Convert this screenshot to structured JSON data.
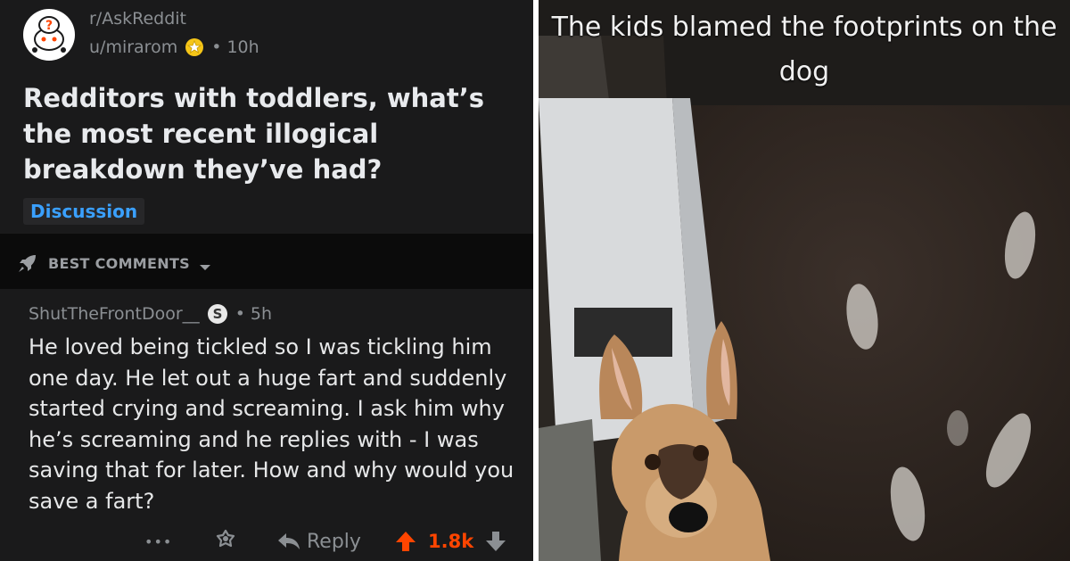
{
  "post": {
    "subreddit": "r/AskReddit",
    "author": "u/mirarom",
    "time": "• 10h",
    "title": "Redditors with toddlers, what’s the most recent illogical breakdown they’ve had?",
    "flair": "Discussion"
  },
  "sort": {
    "label": "BEST COMMENTS"
  },
  "comment": {
    "author": "ShutTheFrontDoor__",
    "time": "• 5h",
    "body": "He loved being tickled so I was tickling him one day. He let out a huge fart and suddenly started crying and screaming. I ask him why he’s screaming and he replies with - I was saving that for later. How and why would you save a fart?",
    "more": "•••",
    "reply_label": "Reply",
    "score": "1.8k"
  },
  "meme": {
    "caption": "The kids blamed the footprints on the dog"
  },
  "colors": {
    "background": "#1a1a1b",
    "link": "#3aa0ff",
    "upvote": "#ff4500"
  },
  "icons": [
    "avatar-icon",
    "award-icon",
    "rocket-icon",
    "chevron-down-icon",
    "award-outline-icon",
    "reply-icon",
    "upvote-icon",
    "downvote-icon"
  ]
}
